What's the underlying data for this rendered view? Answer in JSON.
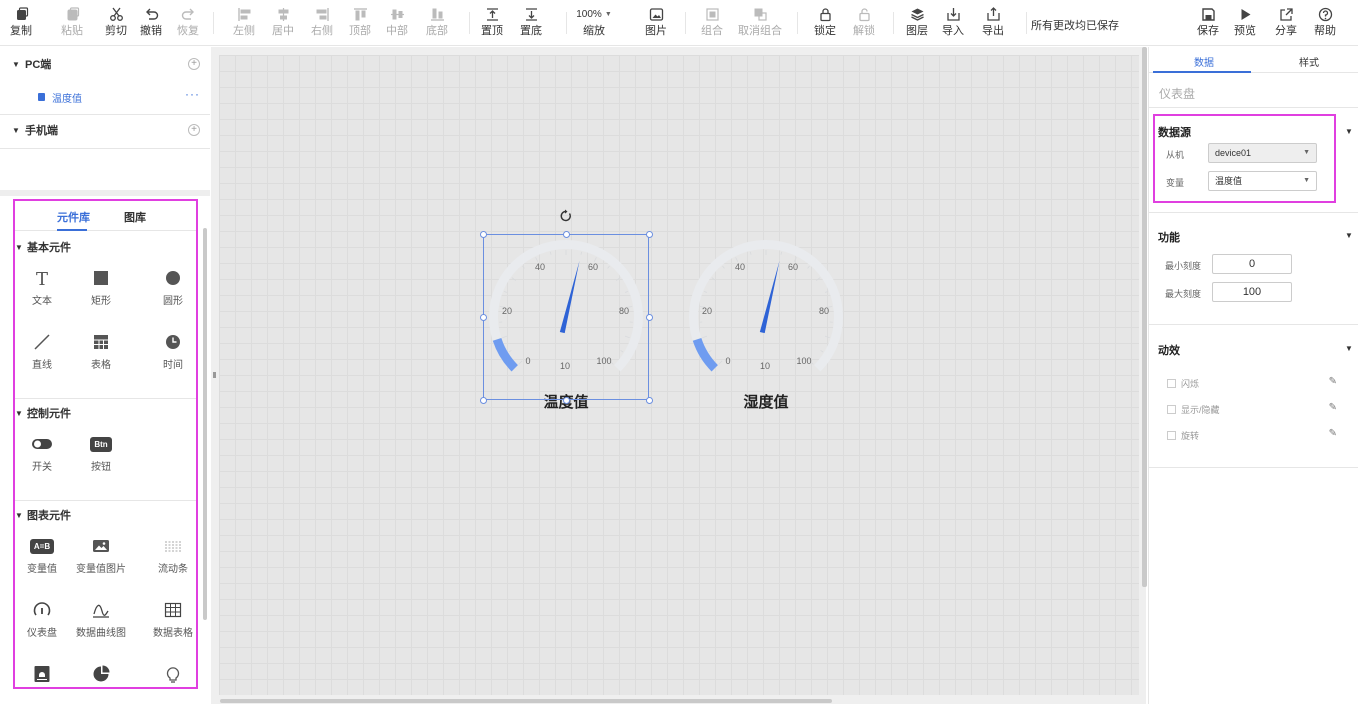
{
  "toolbar": {
    "items": [
      {
        "label": "复制",
        "icon": "copy-icon",
        "enabled": true
      },
      {
        "label": "粘贴",
        "icon": "paste-icon",
        "enabled": false
      },
      {
        "label": "剪切",
        "icon": "scissors-icon",
        "enabled": true
      },
      {
        "label": "撤销",
        "icon": "undo-icon",
        "enabled": true
      },
      {
        "label": "恢复",
        "icon": "redo-icon",
        "enabled": false
      },
      {
        "label": "左侧",
        "icon": "align-left-icon",
        "enabled": false
      },
      {
        "label": "居中",
        "icon": "align-center-icon",
        "enabled": false
      },
      {
        "label": "右侧",
        "icon": "align-right-icon",
        "enabled": false
      },
      {
        "label": "顶部",
        "icon": "align-top-icon",
        "enabled": false
      },
      {
        "label": "中部",
        "icon": "align-middle-icon",
        "enabled": false
      },
      {
        "label": "底部",
        "icon": "align-bottom-icon",
        "enabled": false
      },
      {
        "label": "置顶",
        "icon": "bring-to-front-icon",
        "enabled": true
      },
      {
        "label": "置底",
        "icon": "send-to-back-icon",
        "enabled": true
      },
      {
        "label": "缩放",
        "icon": "zoom-icon",
        "enabled": true
      },
      {
        "label": "图片",
        "icon": "image-icon",
        "enabled": true
      },
      {
        "label": "组合",
        "icon": "group-icon",
        "enabled": false
      },
      {
        "label": "取消组合",
        "icon": "ungroup-icon",
        "enabled": false
      },
      {
        "label": "锁定",
        "icon": "lock-icon",
        "enabled": true
      },
      {
        "label": "解锁",
        "icon": "unlock-icon",
        "enabled": false
      },
      {
        "label": "图层",
        "icon": "layers-icon",
        "enabled": true
      },
      {
        "label": "导入",
        "icon": "import-icon",
        "enabled": true
      },
      {
        "label": "导出",
        "icon": "export-icon",
        "enabled": true
      },
      {
        "label": "保存",
        "icon": "save-icon",
        "enabled": true
      },
      {
        "label": "预览",
        "icon": "play-icon",
        "enabled": true
      },
      {
        "label": "分享",
        "icon": "share-icon",
        "enabled": true
      },
      {
        "label": "帮助",
        "icon": "help-icon",
        "enabled": true
      }
    ],
    "zoom_value": "100%",
    "save_status": "所有更改均已保存"
  },
  "tree": {
    "pc_label": "PC端",
    "pc_node_label": "温度值",
    "pc_node_more": "···",
    "mobile_label": "手机端",
    "plus": "+"
  },
  "library": {
    "tabs": [
      "元件库",
      "图库"
    ],
    "sections": [
      {
        "title": "基本元件",
        "items": [
          {
            "label": "文本",
            "icon": "text-icon"
          },
          {
            "label": "矩形",
            "icon": "rectangle-icon"
          },
          {
            "label": "圆形",
            "icon": "circle-icon"
          },
          {
            "label": "直线",
            "icon": "line-icon"
          },
          {
            "label": "表格",
            "icon": "table-icon"
          },
          {
            "label": "时间",
            "icon": "clock-icon"
          }
        ]
      },
      {
        "title": "控制元件",
        "items": [
          {
            "label": "开关",
            "icon": "toggle-icon"
          },
          {
            "label": "按钮",
            "icon": "button-icon",
            "icon_text": "Btn"
          }
        ]
      },
      {
        "title": "图表元件",
        "items": [
          {
            "label": "变量值",
            "icon": "variable-value-icon",
            "icon_text": "A=B"
          },
          {
            "label": "变量值图片",
            "icon": "variable-image-icon"
          },
          {
            "label": "流动条",
            "icon": "flow-bar-icon"
          },
          {
            "label": "仪表盘",
            "icon": "gauge-icon"
          },
          {
            "label": "数据曲线图",
            "icon": "curve-chart-icon"
          },
          {
            "label": "数据表格",
            "icon": "data-table-icon"
          },
          {
            "label": "报警表格",
            "icon": "alarm-table-icon"
          },
          {
            "label": "饼图",
            "icon": "pie-chart-icon"
          },
          {
            "label": "指示灯",
            "icon": "bulb-icon"
          }
        ]
      }
    ]
  },
  "canvas": {
    "gauges": [
      {
        "title": "温度值",
        "ticks": [
          "0",
          "10",
          "20",
          "40",
          "60",
          "80",
          "100"
        ],
        "min": 0,
        "max": 100,
        "value": 55,
        "selected": true
      },
      {
        "title": "湿度值",
        "ticks": [
          "0",
          "10",
          "20",
          "40",
          "60",
          "80",
          "100"
        ],
        "min": 0,
        "max": 100,
        "value": 55,
        "selected": false
      }
    ],
    "colors": {
      "gauge_track": "#e9ebee",
      "gauge_fill": "#6f9cf0",
      "needle": "#2e63d6",
      "selection": "#6b8fe0"
    }
  },
  "right_panel": {
    "tabs": [
      "数据",
      "样式"
    ],
    "component_type": "仪表盘",
    "datasource": {
      "title": "数据源",
      "slave_label": "从机",
      "slave_value": "device01",
      "var_label": "变量",
      "var_value": "温度值"
    },
    "function": {
      "title": "功能",
      "min_label": "最小刻度",
      "min_value": "0",
      "max_label": "最大刻度",
      "max_value": "100"
    },
    "effects": {
      "title": "动效",
      "items": [
        "闪烁",
        "显示/隐藏",
        "旋转"
      ]
    }
  },
  "colors": {
    "accent": "#3a6fd8",
    "highlight_border": "#e03fe0"
  }
}
